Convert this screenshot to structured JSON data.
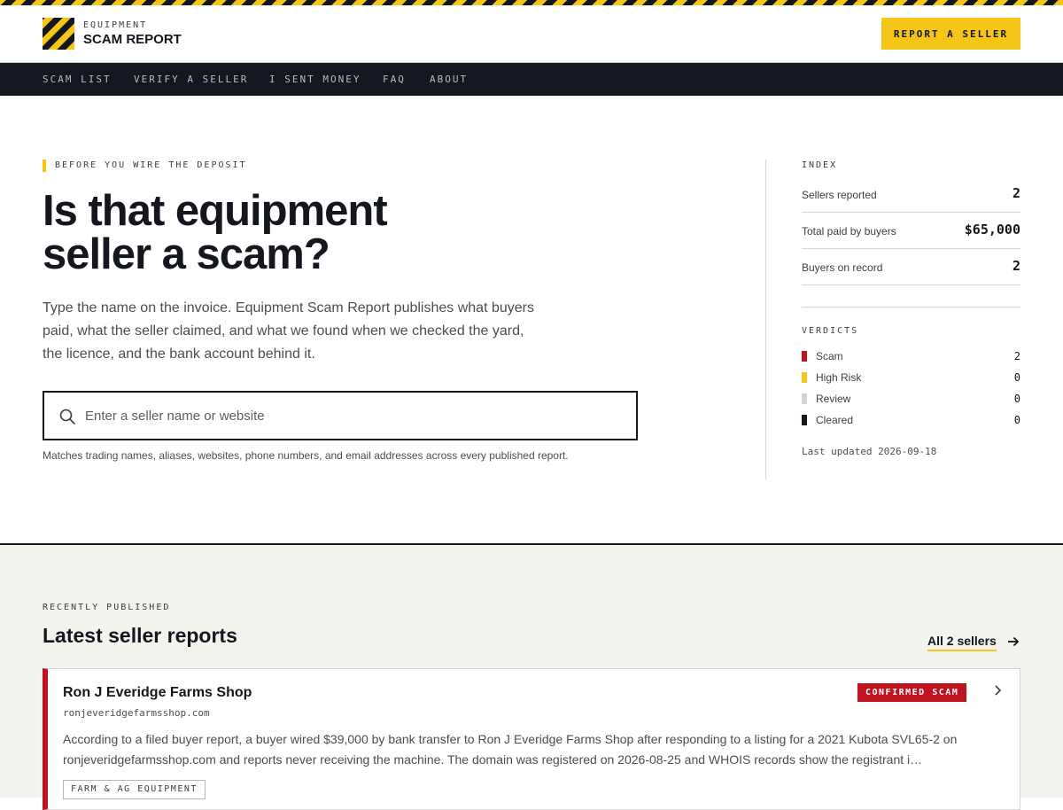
{
  "brand": {
    "small": "EQUIPMENT",
    "name": "SCAM REPORT"
  },
  "header": {
    "report_button": "REPORT A SELLER"
  },
  "nav": {
    "items": [
      "SCAM LIST",
      "VERIFY A SELLER",
      "I SENT MONEY",
      "FAQ",
      "ABOUT"
    ]
  },
  "hero": {
    "eyebrow": "BEFORE YOU WIRE THE DEPOSIT",
    "title": "Is that equipment seller a scam?",
    "description": "Type the name on the invoice. Equipment Scam Report publishes what buyers paid, what the seller claimed, and what we found when we checked the yard, the licence, and the bank account behind it.",
    "search_placeholder": "Enter a seller name or website",
    "search_value": "",
    "search_help": "Matches trading names, aliases, websites, phone numbers, and email addresses across every published report."
  },
  "index": {
    "label": "INDEX",
    "stats": [
      {
        "label": "Sellers reported",
        "value": "2"
      },
      {
        "label": "Total paid by buyers",
        "value": "$65,000"
      },
      {
        "label": "Buyers on record",
        "value": "2"
      }
    ]
  },
  "verdicts": {
    "label": "VERDICTS",
    "items": [
      {
        "label": "Scam",
        "count": "2",
        "color": "#c1121f"
      },
      {
        "label": "High Risk",
        "count": "0",
        "color": "#f5c518"
      },
      {
        "label": "Review",
        "count": "0",
        "color": "#d4d4d4"
      },
      {
        "label": "Cleared",
        "count": "0",
        "color": "#15171f"
      }
    ],
    "last_updated": "Last updated 2026-09-18"
  },
  "recent": {
    "label": "RECENTLY PUBLISHED",
    "title": "Latest seller reports",
    "all_link": "All 2 sellers",
    "reports": [
      {
        "name": "Ron J Everidge Farms Shop",
        "domain": "ronjeveridgefarmsshop.com",
        "badge": "CONFIRMED SCAM",
        "description": "According to a filed buyer report, a buyer wired $39,000 by bank transfer to Ron J Everidge Farms Shop after responding to a listing for a 2021 Kubota SVL65-2 on ronjeveridgefarmsshop.com and reports never receiving the machine. The domain was registered on 2026-08-25 and WHOIS records show the registrant i…",
        "tag": "FARM & AG EQUIPMENT"
      }
    ]
  },
  "colors": {
    "accent": "#f5c518",
    "dark": "#15171f",
    "scam": "#c1121f"
  },
  "icons": [
    "search-icon",
    "arrow-right-icon",
    "chevron-right-icon",
    "hazard-logo-icon"
  ]
}
